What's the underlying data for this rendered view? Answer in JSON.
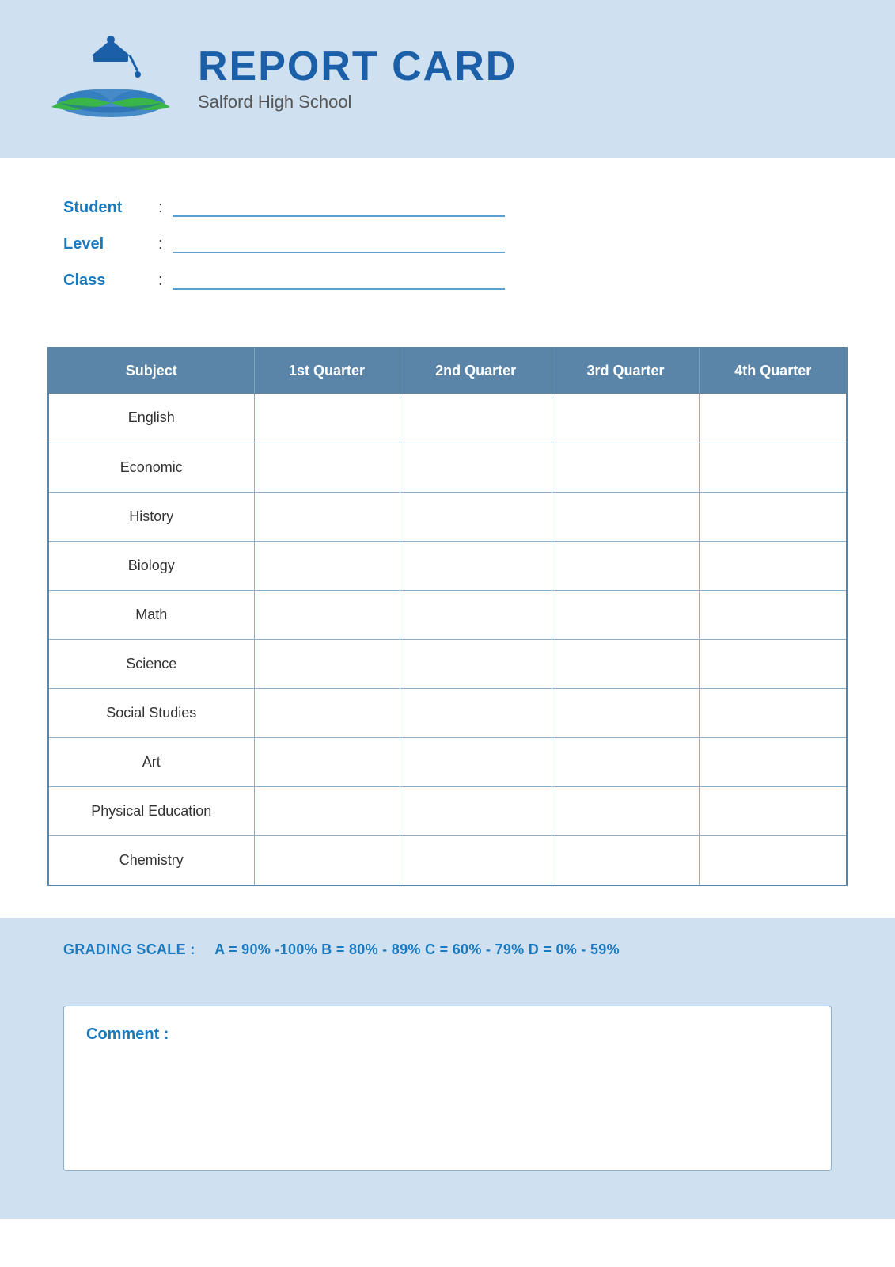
{
  "header": {
    "title": "REPORT CARD",
    "school": "Salford High School"
  },
  "student_info": {
    "student_label": "Student",
    "level_label": "Level",
    "class_label": "Class",
    "colon": ":"
  },
  "table": {
    "headers": [
      "Subject",
      "1st Quarter",
      "2nd Quarter",
      "3rd Quarter",
      "4th Quarter"
    ],
    "rows": [
      {
        "subject": "English"
      },
      {
        "subject": "Economic"
      },
      {
        "subject": "History"
      },
      {
        "subject": "Biology"
      },
      {
        "subject": "Math"
      },
      {
        "subject": "Science"
      },
      {
        "subject": "Social Studies"
      },
      {
        "subject": "Art"
      },
      {
        "subject": "Physical Education"
      },
      {
        "subject": "Chemistry"
      }
    ]
  },
  "grading_scale": {
    "label": "GRADING SCALE :",
    "values": "A = 90% -100%  B = 80% - 89%  C = 60% - 79%  D = 0% - 59%"
  },
  "comment": {
    "label": "Comment :"
  }
}
